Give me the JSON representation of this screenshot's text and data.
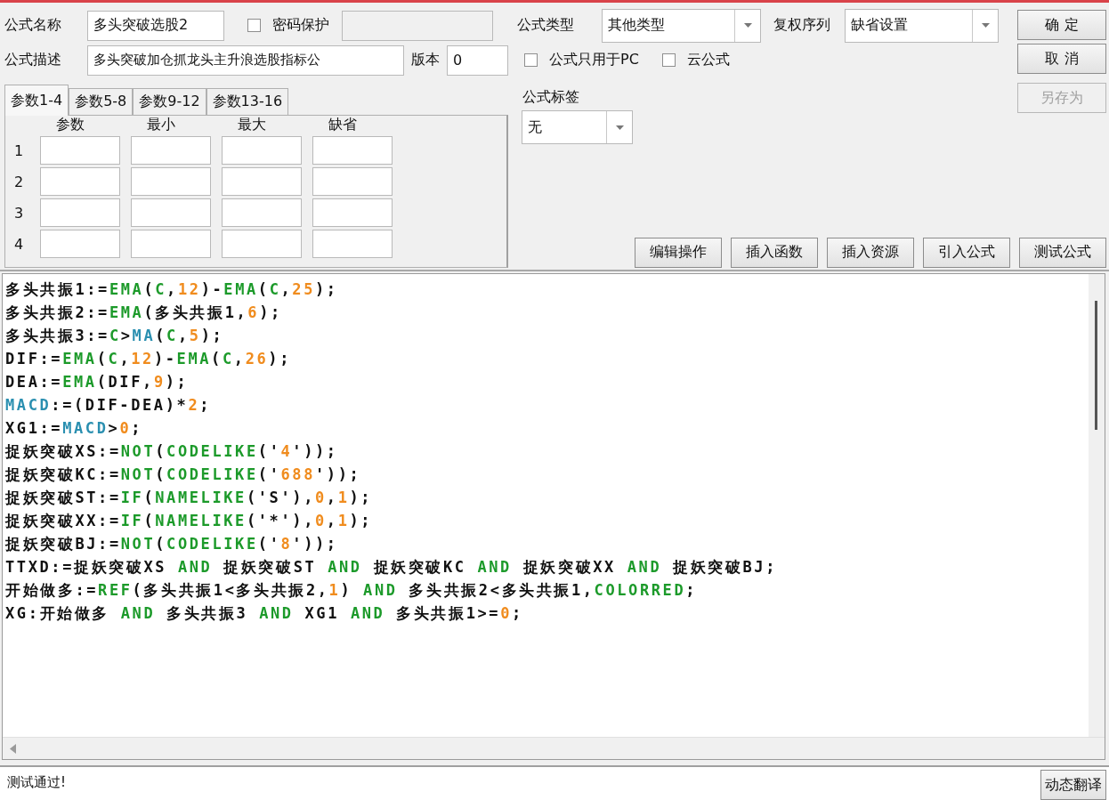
{
  "formula_name": {
    "label": "公式名称",
    "value": "多头突破选股2"
  },
  "password": {
    "label": "密码保护",
    "checked": false
  },
  "password_field": {
    "disabled": true
  },
  "description": {
    "label": "公式描述",
    "value": "多头突破加仓抓龙头主升浪选股指标公"
  },
  "version": {
    "label": "版本",
    "value": "0"
  },
  "param_tabs": [
    {
      "label": "参数1-4",
      "selected": true
    },
    {
      "label": "参数5-8",
      "selected": false
    },
    {
      "label": "参数9-12",
      "selected": false
    },
    {
      "label": "参数13-16",
      "selected": false
    }
  ],
  "param_table": {
    "columns": [
      "参数",
      "最小",
      "最大",
      "缺省"
    ],
    "rows": [
      "1",
      "2",
      "3",
      "4"
    ]
  },
  "formula_type": {
    "label": "公式类型",
    "value": "其他类型"
  },
  "rights_series": {
    "label": "复权序列",
    "value": "缺省设置"
  },
  "options": [
    {
      "label": "公式只用于PC",
      "checked": false
    },
    {
      "label": "云公式",
      "checked": false
    }
  ],
  "formula_tag": {
    "label": "公式标签",
    "value": "无"
  },
  "side_buttons": [
    {
      "label": "确 定",
      "disabled": false
    },
    {
      "label": "取 消",
      "disabled": false
    },
    {
      "label": "另存为",
      "disabled": true
    }
  ],
  "tool_buttons": [
    "编辑操作",
    "插入函数",
    "插入资源",
    "引入公式",
    "测试公式"
  ],
  "code_lines": [
    [
      {
        "kind": "plain",
        "text": "多头共振1:="
      },
      {
        "kind": "func",
        "text": "EMA"
      },
      {
        "kind": "plain",
        "text": "("
      },
      {
        "kind": "func",
        "text": "C"
      },
      {
        "kind": "plain",
        "text": ","
      },
      {
        "kind": "number",
        "text": "12"
      },
      {
        "kind": "plain",
        "text": ")-"
      },
      {
        "kind": "func",
        "text": "EMA"
      },
      {
        "kind": "plain",
        "text": "("
      },
      {
        "kind": "func",
        "text": "C"
      },
      {
        "kind": "plain",
        "text": ","
      },
      {
        "kind": "number",
        "text": "25"
      },
      {
        "kind": "plain",
        "text": ");"
      }
    ],
    [
      {
        "kind": "plain",
        "text": "多头共振2:="
      },
      {
        "kind": "func",
        "text": "EMA"
      },
      {
        "kind": "plain",
        "text": "(多头共振1,"
      },
      {
        "kind": "number",
        "text": "6"
      },
      {
        "kind": "plain",
        "text": ");"
      }
    ],
    [
      {
        "kind": "plain",
        "text": "多头共振3:="
      },
      {
        "kind": "func",
        "text": "C"
      },
      {
        "kind": "plain",
        "text": ">"
      },
      {
        "kind": "ref",
        "text": "MA"
      },
      {
        "kind": "plain",
        "text": "("
      },
      {
        "kind": "func",
        "text": "C"
      },
      {
        "kind": "plain",
        "text": ","
      },
      {
        "kind": "number",
        "text": "5"
      },
      {
        "kind": "plain",
        "text": ");"
      }
    ],
    [
      {
        "kind": "plain",
        "text": "DIF:="
      },
      {
        "kind": "func",
        "text": "EMA"
      },
      {
        "kind": "plain",
        "text": "("
      },
      {
        "kind": "func",
        "text": "C"
      },
      {
        "kind": "plain",
        "text": ","
      },
      {
        "kind": "number",
        "text": "12"
      },
      {
        "kind": "plain",
        "text": ")-"
      },
      {
        "kind": "func",
        "text": "EMA"
      },
      {
        "kind": "plain",
        "text": "("
      },
      {
        "kind": "func",
        "text": "C"
      },
      {
        "kind": "plain",
        "text": ","
      },
      {
        "kind": "number",
        "text": "26"
      },
      {
        "kind": "plain",
        "text": ");"
      }
    ],
    [
      {
        "kind": "plain",
        "text": "DEA:="
      },
      {
        "kind": "func",
        "text": "EMA"
      },
      {
        "kind": "plain",
        "text": "(DIF,"
      },
      {
        "kind": "number",
        "text": "9"
      },
      {
        "kind": "plain",
        "text": ");"
      }
    ],
    [
      {
        "kind": "ref",
        "text": "MACD"
      },
      {
        "kind": "plain",
        "text": ":=(DIF-DEA)*"
      },
      {
        "kind": "number",
        "text": "2"
      },
      {
        "kind": "plain",
        "text": ";"
      }
    ],
    [
      {
        "kind": "plain",
        "text": "XG1:="
      },
      {
        "kind": "ref",
        "text": "MACD"
      },
      {
        "kind": "plain",
        "text": ">"
      },
      {
        "kind": "number",
        "text": "0"
      },
      {
        "kind": "plain",
        "text": ";"
      }
    ],
    [
      {
        "kind": "plain",
        "text": "捉妖突破XS:="
      },
      {
        "kind": "func",
        "text": "NOT"
      },
      {
        "kind": "plain",
        "text": "("
      },
      {
        "kind": "func",
        "text": "CODELIKE"
      },
      {
        "kind": "plain",
        "text": "('"
      },
      {
        "kind": "number",
        "text": "4"
      },
      {
        "kind": "plain",
        "text": "'));"
      }
    ],
    [
      {
        "kind": "plain",
        "text": "捉妖突破KC:="
      },
      {
        "kind": "func",
        "text": "NOT"
      },
      {
        "kind": "plain",
        "text": "("
      },
      {
        "kind": "func",
        "text": "CODELIKE"
      },
      {
        "kind": "plain",
        "text": "('"
      },
      {
        "kind": "number",
        "text": "688"
      },
      {
        "kind": "plain",
        "text": "'));"
      }
    ],
    [
      {
        "kind": "plain",
        "text": "捉妖突破ST:="
      },
      {
        "kind": "func",
        "text": "IF"
      },
      {
        "kind": "plain",
        "text": "("
      },
      {
        "kind": "func",
        "text": "NAMELIKE"
      },
      {
        "kind": "plain",
        "text": "('S'),"
      },
      {
        "kind": "number",
        "text": "0"
      },
      {
        "kind": "plain",
        "text": ","
      },
      {
        "kind": "number",
        "text": "1"
      },
      {
        "kind": "plain",
        "text": ");"
      }
    ],
    [
      {
        "kind": "plain",
        "text": "捉妖突破XX:="
      },
      {
        "kind": "func",
        "text": "IF"
      },
      {
        "kind": "plain",
        "text": "("
      },
      {
        "kind": "func",
        "text": "NAMELIKE"
      },
      {
        "kind": "plain",
        "text": "('*'),"
      },
      {
        "kind": "number",
        "text": "0"
      },
      {
        "kind": "plain",
        "text": ","
      },
      {
        "kind": "number",
        "text": "1"
      },
      {
        "kind": "plain",
        "text": ");"
      }
    ],
    [
      {
        "kind": "plain",
        "text": "捉妖突破BJ:="
      },
      {
        "kind": "func",
        "text": "NOT"
      },
      {
        "kind": "plain",
        "text": "("
      },
      {
        "kind": "func",
        "text": "CODELIKE"
      },
      {
        "kind": "plain",
        "text": "('"
      },
      {
        "kind": "number",
        "text": "8"
      },
      {
        "kind": "plain",
        "text": "'));"
      }
    ],
    [
      {
        "kind": "plain",
        "text": "TTXD:=捉妖突破XS "
      },
      {
        "kind": "func",
        "text": "AND"
      },
      {
        "kind": "plain",
        "text": " 捉妖突破ST "
      },
      {
        "kind": "func",
        "text": "AND"
      },
      {
        "kind": "plain",
        "text": " 捉妖突破KC "
      },
      {
        "kind": "func",
        "text": "AND"
      },
      {
        "kind": "plain",
        "text": " 捉妖突破XX "
      },
      {
        "kind": "func",
        "text": "AND"
      },
      {
        "kind": "plain",
        "text": " 捉妖突破BJ;"
      }
    ],
    [
      {
        "kind": "plain",
        "text": "开始做多:="
      },
      {
        "kind": "func",
        "text": "REF"
      },
      {
        "kind": "plain",
        "text": "(多头共振1<多头共振2,"
      },
      {
        "kind": "number",
        "text": "1"
      },
      {
        "kind": "plain",
        "text": ") "
      },
      {
        "kind": "func",
        "text": "AND"
      },
      {
        "kind": "plain",
        "text": " 多头共振2<多头共振1,"
      },
      {
        "kind": "func",
        "text": "COLORRED"
      },
      {
        "kind": "plain",
        "text": ";"
      }
    ],
    [
      {
        "kind": "plain",
        "text": "XG:开始做多 "
      },
      {
        "kind": "func",
        "text": "AND"
      },
      {
        "kind": "plain",
        "text": " 多头共振3 "
      },
      {
        "kind": "func",
        "text": "AND"
      },
      {
        "kind": "plain",
        "text": " XG1 "
      },
      {
        "kind": "func",
        "text": "AND"
      },
      {
        "kind": "plain",
        "text": " 多头共振1>="
      },
      {
        "kind": "number",
        "text": "0"
      },
      {
        "kind": "plain",
        "text": ";"
      }
    ]
  ],
  "status": {
    "message": "测试通过!"
  },
  "translate_button": "动态翻译"
}
